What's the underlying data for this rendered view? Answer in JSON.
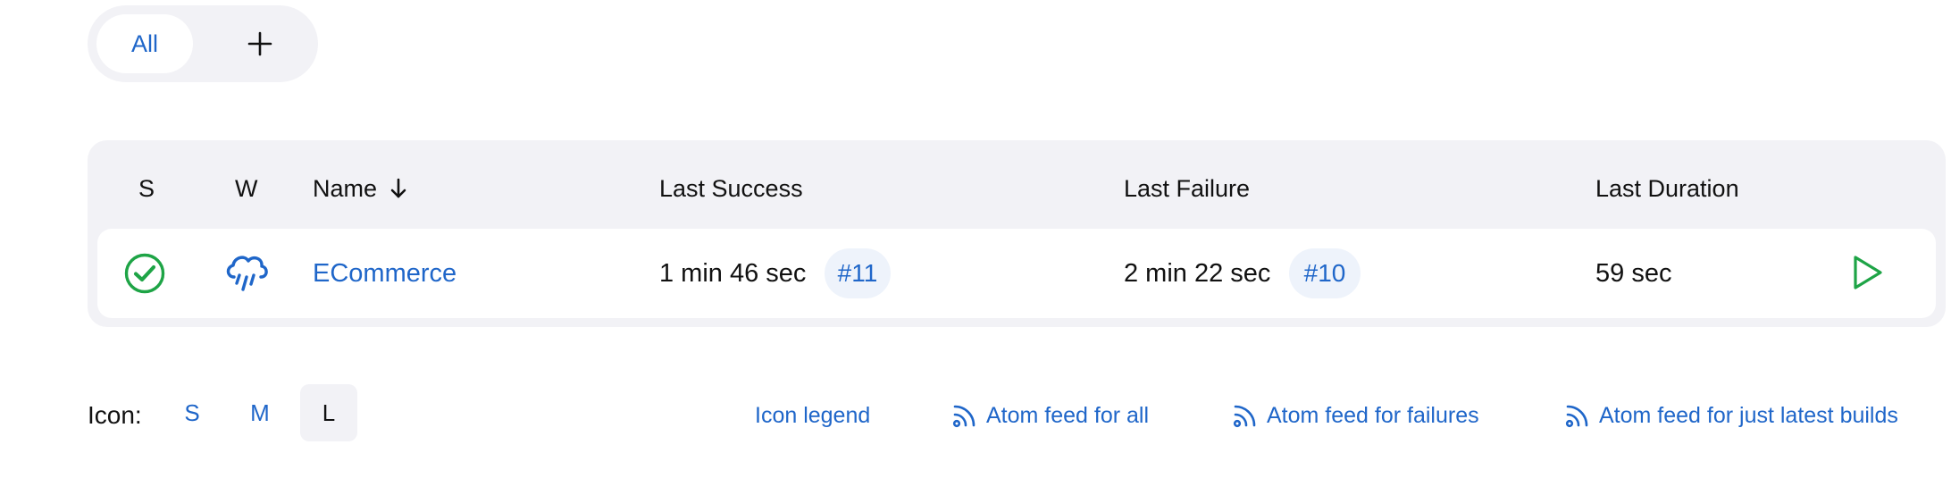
{
  "view_tabs": {
    "all_label": "All",
    "add_icon": "plus-icon"
  },
  "table": {
    "headers": {
      "status": "S",
      "weather": "W",
      "name": "Name",
      "name_sort_icon": "arrow-down-icon",
      "last_success": "Last Success",
      "last_failure": "Last Failure",
      "last_duration": "Last Duration"
    },
    "rows": [
      {
        "status_icon": "success-check-icon",
        "status_color": "#1ea446",
        "weather_icon": "rain-cloud-icon",
        "weather_color": "#1f66c9",
        "name": "ECommerce",
        "last_success_time": "1 min 46 sec",
        "last_success_build": "#11",
        "last_failure_time": "2 min 22 sec",
        "last_failure_build": "#10",
        "last_duration": "59 sec",
        "action_icon": "play-icon"
      }
    ]
  },
  "footer": {
    "icon_label": "Icon:",
    "sizes": [
      "S",
      "M",
      "L"
    ],
    "selected_size": "L",
    "icon_legend": "Icon legend",
    "feed_all": "Atom feed for all",
    "feed_failures": "Atom feed for failures",
    "feed_latest": "Atom feed for just latest builds",
    "feed_icon": "rss-icon"
  },
  "colors": {
    "accent": "#1f66c9",
    "success": "#1ea446",
    "panel_bg": "#f2f2f6"
  }
}
